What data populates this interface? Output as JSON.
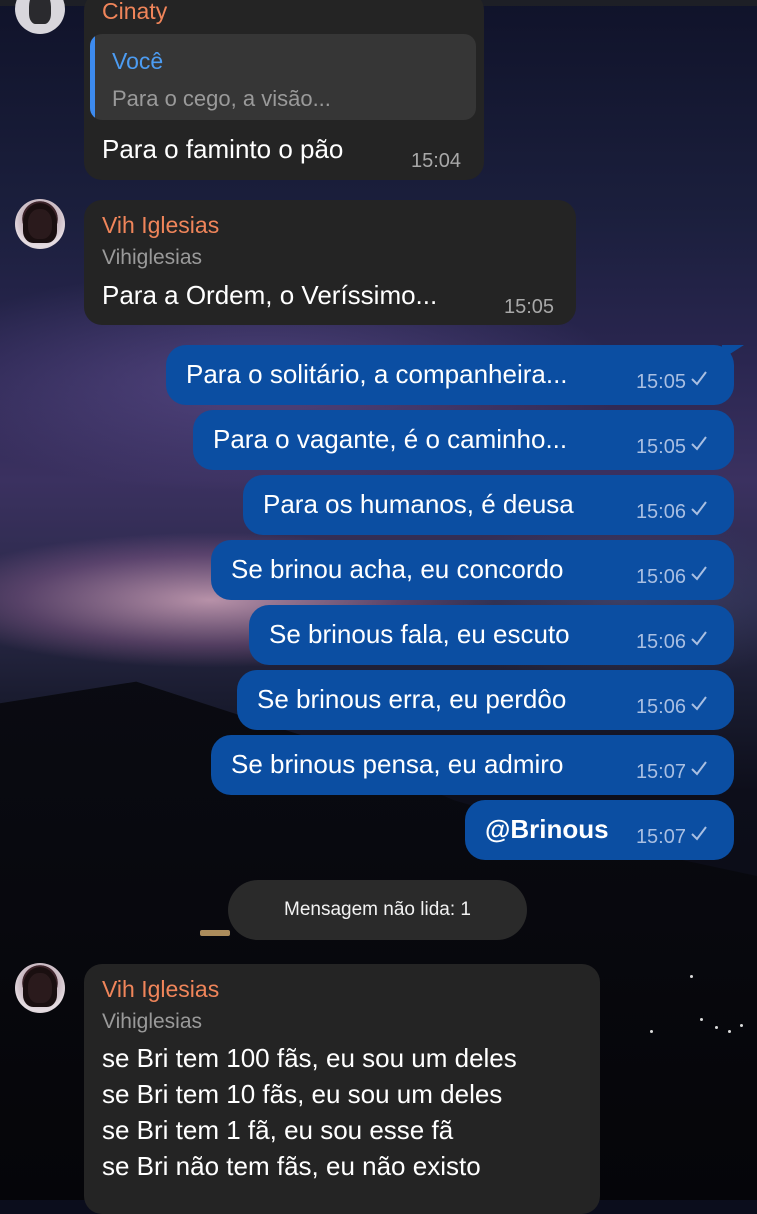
{
  "messages": [
    {
      "sender_partial": "Cinaty",
      "reply": {
        "name": "Você",
        "text": "Para o cego, a visão..."
      },
      "text": "Para o faminto o pão",
      "time": "15:04"
    },
    {
      "sender": "Vih Iglesias",
      "username": "Vihiglesias",
      "text": "Para a Ordem, o Veríssimo...",
      "time": "15:05"
    }
  ],
  "outgoing": [
    {
      "text": "Para o solitário, a companheira...",
      "time": "15:05"
    },
    {
      "text": "Para o vagante, é o caminho...",
      "time": "15:05"
    },
    {
      "text": "Para os humanos, é deusa",
      "time": "15:06"
    },
    {
      "text": "Se brinou acha, eu concordo",
      "time": "15:06"
    },
    {
      "text": "Se brinous fala, eu escuto",
      "time": "15:06"
    },
    {
      "text": "Se brinous erra, eu perdôo",
      "time": "15:06"
    },
    {
      "text": "Se brinous pensa, eu admiro",
      "time": "15:07"
    },
    {
      "text": "@Brinous",
      "time": "15:07"
    }
  ],
  "unread_label": "Mensagem não lida: 1",
  "last_message": {
    "sender": "Vih Iglesias",
    "username": "Vihiglesias",
    "lines": [
      "se Bri tem 100 fãs, eu sou um deles",
      "se Bri tem 10 fãs, eu sou um deles",
      "se Bri tem 1 fã, eu sou esse fã",
      "se Bri não tem fãs, eu não existo"
    ]
  },
  "icons": {
    "read_check": "checkmark-icon"
  },
  "colors": {
    "incoming_bubble": "#242424",
    "outgoing_bubble": "#0b4ea2",
    "sender_name": "#f0855a",
    "reply_accent": "#3d8bef"
  }
}
